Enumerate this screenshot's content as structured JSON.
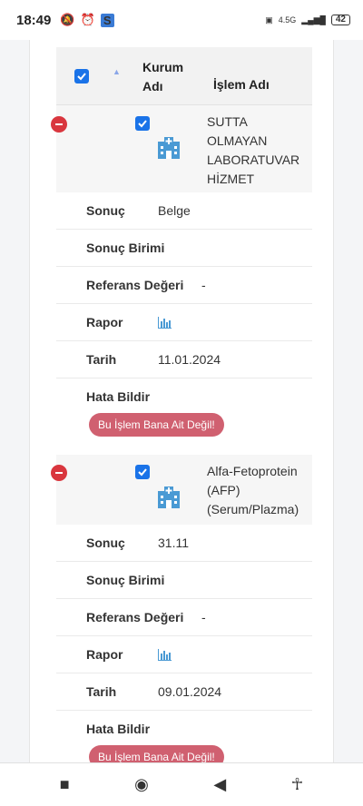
{
  "status": {
    "time": "18:49",
    "network": "4.5G",
    "battery": "42"
  },
  "table": {
    "header": {
      "kurum_line1": "Kurum",
      "kurum_line2": "Adı",
      "islem": "İşlem Adı"
    },
    "labels": {
      "sonuc": "Sonuç",
      "sonuc_birimi": "Sonuç Birimi",
      "referans": "Referans Değeri",
      "rapor": "Rapor",
      "tarih": "Tarih",
      "hata": "Hata Bildir",
      "button": "Bu İşlem Bana Ait Değil!"
    },
    "records": [
      {
        "islem_lines": [
          "SUTTA",
          "OLMAYAN",
          "LABORATUVAR",
          "HİZMET"
        ],
        "sonuc": "Belge",
        "sonuc_birimi": "",
        "referans": "-",
        "tarih": "11.01.2024"
      },
      {
        "islem_lines": [
          "Alfa-Fetoprotein",
          "(AFP)",
          "(Serum/Plazma)"
        ],
        "sonuc": "31.11",
        "sonuc_birimi": "",
        "referans": "-",
        "tarih": "09.01.2024"
      }
    ]
  },
  "icons": {
    "minus": "remove-circle-icon",
    "hospital": "hospital-building-icon",
    "rapor": "bar-chart-icon",
    "checkbox": "checked-checkbox-icon"
  },
  "colors": {
    "accent": "#1a73e8",
    "danger": "#d9363e",
    "button": "#d06070",
    "hospital": "#4a9ad4"
  }
}
